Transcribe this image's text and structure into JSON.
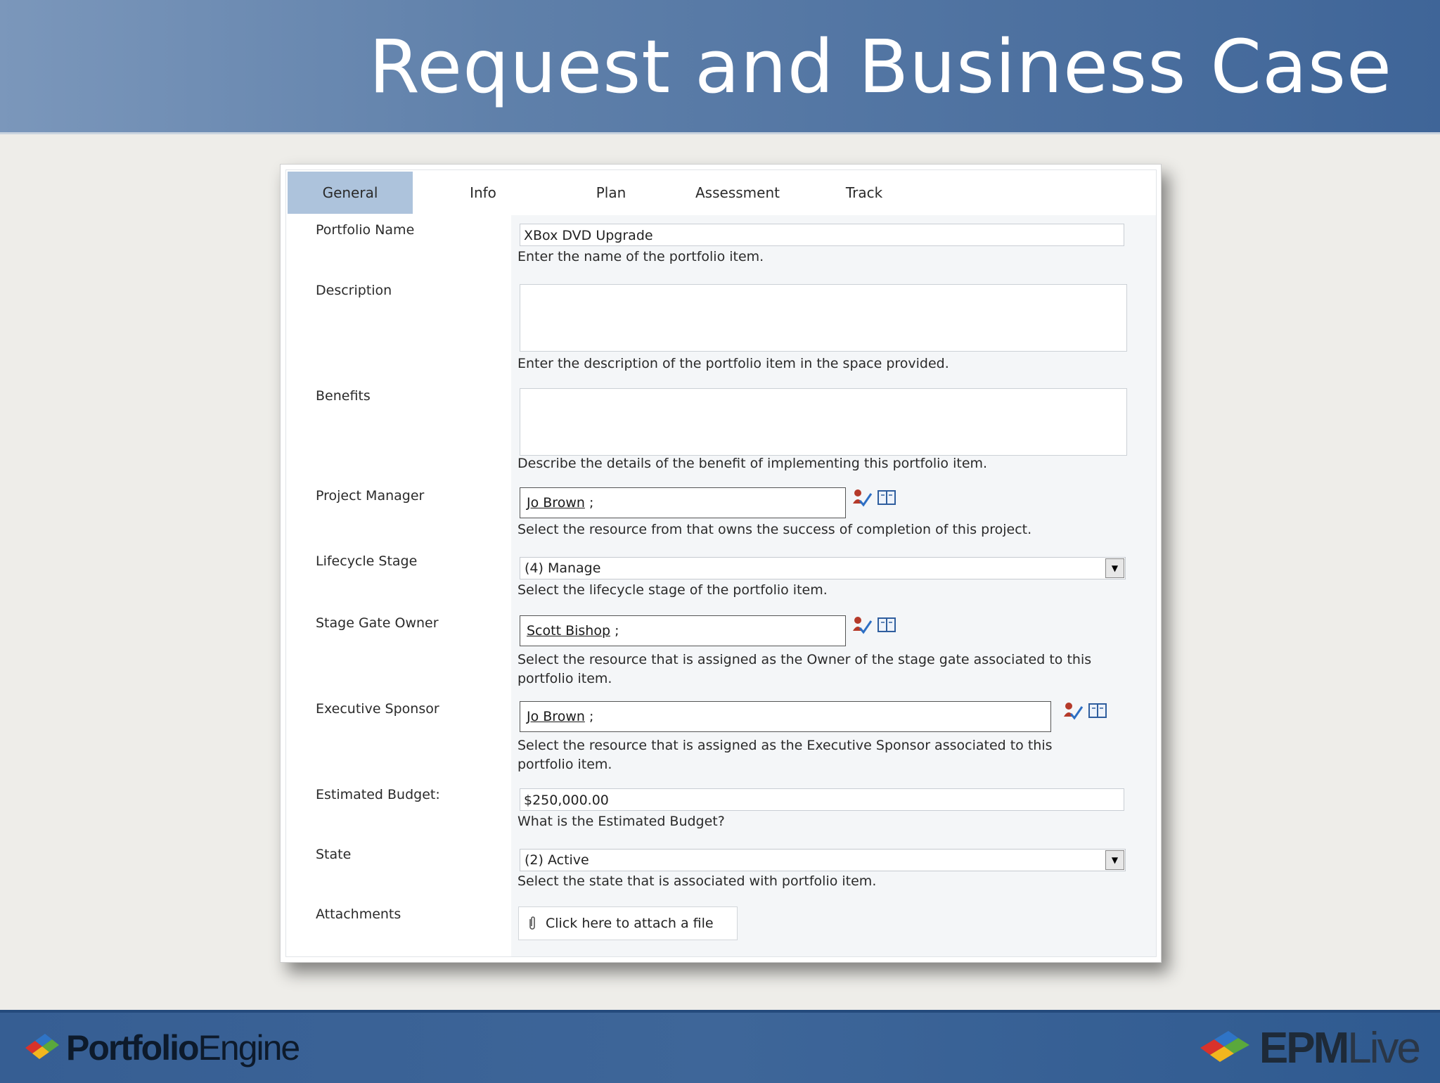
{
  "slide": {
    "title": "Request and Business Case"
  },
  "tabs": [
    {
      "label": "General",
      "active": true
    },
    {
      "label": "Info"
    },
    {
      "label": "Plan"
    },
    {
      "label": "Assessment"
    },
    {
      "label": "Track"
    }
  ],
  "fields": {
    "portfolio_name": {
      "label": "Portfolio Name",
      "value": "XBox DVD Upgrade",
      "hint": "Enter the name of the portfolio item."
    },
    "description": {
      "label": "Description",
      "value": "",
      "hint": "Enter the description of the portfolio item in the space provided."
    },
    "benefits": {
      "label": "Benefits",
      "value": "",
      "hint": "Describe the details of the benefit of implementing this portfolio item."
    },
    "project_manager": {
      "label": "Project Manager",
      "value": "Jo Brown",
      "separator": ";",
      "hint": "Select the resource from that owns the success of completion of this project."
    },
    "lifecycle_stage": {
      "label": "Lifecycle Stage",
      "value": "(4) Manage",
      "hint": "Select the lifecycle stage of the portfolio item."
    },
    "stage_gate_owner": {
      "label": "Stage Gate Owner",
      "value": "Scott Bishop",
      "separator": ";",
      "hint_line1": "Select the resource that is assigned as the Owner of the stage gate associated to this",
      "hint_line2": "portfolio item."
    },
    "executive_sponsor": {
      "label": "Executive Sponsor",
      "value": "Jo Brown",
      "separator": ";",
      "hint_line1": "Select the resource that is assigned as the Executive Sponsor associated to this",
      "hint_line2": "portfolio item."
    },
    "estimated_budget": {
      "label": "Estimated Budget:",
      "value": "$250,000.00",
      "hint": "What is the Estimated Budget?"
    },
    "state": {
      "label": "State",
      "value": "(2) Active",
      "hint": "Select the state that is associated with portfolio item."
    },
    "attachments": {
      "label": "Attachments",
      "button_label": "Click here to attach a file"
    }
  },
  "icons": {
    "check_names": "check-names-icon",
    "browse": "address-book-icon",
    "dropdown": "dropdown-arrow-icon",
    "attach": "paperclip-icon"
  },
  "footer": {
    "left_logo": {
      "part1": "Portfolio",
      "part2": "Engine"
    },
    "right_logo": {
      "part1": "EPM",
      "part2": "Live"
    }
  },
  "colors": {
    "header_blue": "#5f80aa",
    "footer_blue": "#3e6699",
    "active_tab": "#adc3dc"
  }
}
